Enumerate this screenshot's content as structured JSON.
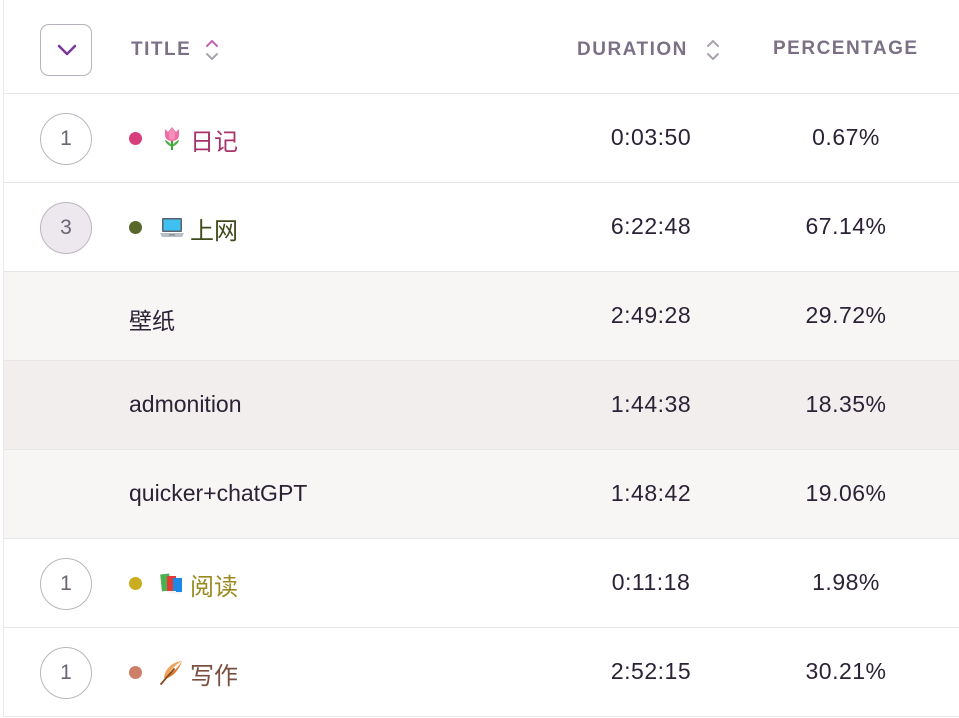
{
  "header": {
    "title_label": "TITLE",
    "duration_label": "DURATION",
    "percentage_label": "PERCENTAGE",
    "collapse_icon": "chevron-down-icon",
    "sort_icon": "sort-updown-icon"
  },
  "rows": [
    {
      "count": "1",
      "dot_color": "#d63f7c",
      "emoji": "tulip",
      "name": "日记",
      "name_color": "#a8336a",
      "duration": "0:03:50",
      "percentage": "0.67%"
    },
    {
      "count": "3",
      "dot_color": "#58672a",
      "emoji": "laptop",
      "name": "上网",
      "name_color": "#3d4a1a",
      "duration": "6:22:48",
      "percentage": "67.14%"
    },
    {
      "count": "1",
      "dot_color": "#c9ad1e",
      "emoji": "books",
      "name": "阅读",
      "name_color": "#9a8a1f",
      "duration": "0:11:18",
      "percentage": "1.98%"
    },
    {
      "count": "1",
      "dot_color": "#cd7f6a",
      "emoji": "feather",
      "name": "写作",
      "name_color": "#7a4f40",
      "duration": "2:52:15",
      "percentage": "30.21%"
    }
  ],
  "subrows": [
    {
      "name": "壁纸",
      "duration": "2:49:28",
      "percentage": "29.72%"
    },
    {
      "name": "admonition",
      "duration": "1:44:38",
      "percentage": "18.35%"
    },
    {
      "name": "quicker+chatGPT",
      "duration": "1:48:42",
      "percentage": "19.06%"
    }
  ],
  "colors": {
    "accent": "#7a3a9a",
    "sort_up": "#c065b5",
    "muted": "#7b7085"
  }
}
